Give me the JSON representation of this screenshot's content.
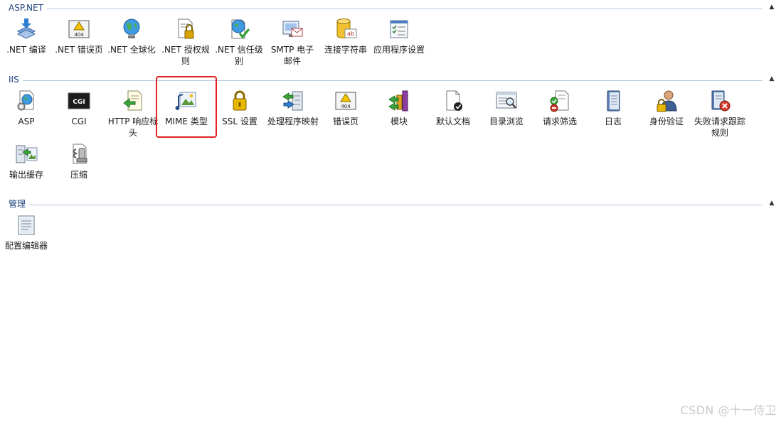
{
  "groups": [
    {
      "title": "ASP.NET",
      "items": [
        {
          "label": ".NET 编译",
          "icon": "net-compilation-icon"
        },
        {
          "label": ".NET 错误页",
          "icon": "net-error-pages-icon",
          "badge": "404"
        },
        {
          "label": ".NET 全球化",
          "icon": "net-globalization-icon"
        },
        {
          "label": ".NET 授权规则",
          "icon": "net-authorization-rules-icon"
        },
        {
          "label": ".NET 信任级别",
          "icon": "net-trust-levels-icon"
        },
        {
          "label": "SMTP 电子邮件",
          "icon": "smtp-email-icon"
        },
        {
          "label": "连接字符串",
          "icon": "connection-strings-icon",
          "badge": "ab"
        },
        {
          "label": "应用程序设置",
          "icon": "application-settings-icon"
        }
      ]
    },
    {
      "title": "IIS",
      "items": [
        {
          "label": "ASP",
          "icon": "asp-icon"
        },
        {
          "label": "CGI",
          "icon": "cgi-icon",
          "badge": "CGI"
        },
        {
          "label": "HTTP 响应标头",
          "icon": "http-response-headers-icon"
        },
        {
          "label": "MIME 类型",
          "icon": "mime-types-icon"
        },
        {
          "label": "SSL 设置",
          "icon": "ssl-settings-icon"
        },
        {
          "label": "处理程序映射",
          "icon": "handler-mappings-icon"
        },
        {
          "label": "错误页",
          "icon": "error-pages-icon",
          "badge": "404"
        },
        {
          "label": "模块",
          "icon": "modules-icon"
        },
        {
          "label": "默认文档",
          "icon": "default-document-icon"
        },
        {
          "label": "目录浏览",
          "icon": "directory-browsing-icon"
        },
        {
          "label": "请求筛选",
          "icon": "request-filtering-icon"
        },
        {
          "label": "日志",
          "icon": "logging-icon"
        },
        {
          "label": "身份验证",
          "icon": "authentication-icon"
        },
        {
          "label": "失败请求跟踪规则",
          "icon": "failed-request-tracing-icon"
        },
        {
          "label": "输出缓存",
          "icon": "output-caching-icon"
        },
        {
          "label": "压缩",
          "icon": "compression-icon"
        }
      ]
    },
    {
      "title": "管理",
      "items": [
        {
          "label": "配置编辑器",
          "icon": "configuration-editor-icon"
        }
      ]
    }
  ],
  "collapse_glyph": "▲",
  "highlighted_item": "MIME 类型",
  "watermark": "CSDN @十一侍卫"
}
